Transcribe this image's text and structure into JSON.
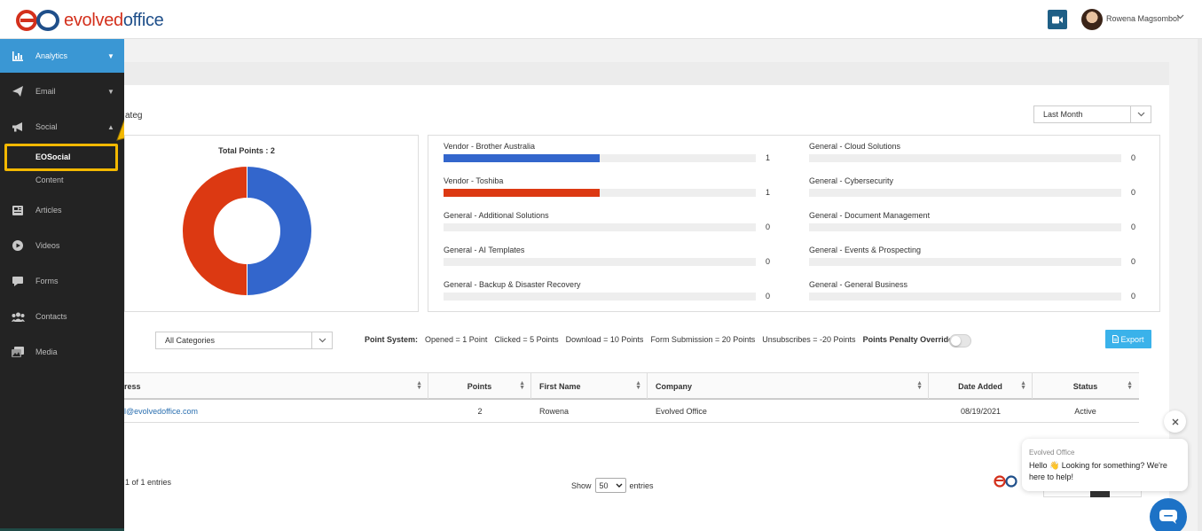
{
  "header": {
    "logo_evolved": "evolved",
    "logo_office": "office",
    "user_name": "Rowena Magsombol",
    "icons": {
      "video": "video-camera-icon",
      "chevron": "chevron-down-icon"
    }
  },
  "sidebar": {
    "items": [
      {
        "label": "Analytics",
        "icon": "bar-chart-icon",
        "active": true
      },
      {
        "label": "Email",
        "icon": "paper-plane-icon"
      },
      {
        "label": "Social",
        "icon": "megaphone-icon",
        "expanded": true
      },
      {
        "label": "Articles",
        "icon": "newspaper-icon"
      },
      {
        "label": "Videos",
        "icon": "play-circle-icon"
      },
      {
        "label": "Forms",
        "icon": "comment-icon"
      },
      {
        "label": "Contacts",
        "icon": "users-icon"
      },
      {
        "label": "Media",
        "icon": "images-icon"
      }
    ],
    "social_sub": [
      "EOSocial",
      "Content"
    ],
    "colors": {
      "active": "#3a97d4",
      "highlight": "#f3b800"
    }
  },
  "main": {
    "clipped_title": "ateg",
    "period_select": "Last Month",
    "category_select": "All Categories",
    "chart_data": {
      "type": "pie",
      "title": "Total Points : 2",
      "categories": [
        "Vendor - Brother Australia",
        "Vendor - Toshiba"
      ],
      "values": [
        1,
        1
      ],
      "colors": [
        "#3366cc",
        "#dc3912"
      ],
      "donut": true
    },
    "category_bars": {
      "max": 2,
      "items": [
        {
          "label": "Vendor - Brother Australia",
          "value": 1,
          "color": "#3366cc"
        },
        {
          "label": "Vendor - Toshiba",
          "value": 1,
          "color": "#dc3912"
        },
        {
          "label": "General - Additional Solutions",
          "value": 0
        },
        {
          "label": "General - AI Templates",
          "value": 0
        },
        {
          "label": "General - Backup & Disaster Recovery",
          "value": 0
        },
        {
          "label": "General - Cloud Solutions",
          "value": 0
        },
        {
          "label": "General - Cybersecurity",
          "value": 0
        },
        {
          "label": "General - Document Management",
          "value": 0
        },
        {
          "label": "General - Events & Prospecting",
          "value": 0
        },
        {
          "label": "General - General Business",
          "value": 0
        }
      ]
    },
    "point_system": {
      "label": "Point System:",
      "rules": [
        "Opened = 1 Point",
        "Clicked = 5 Points",
        "Download = 10 Points",
        "Form Submission = 20 Points",
        "Unsubscribes = -20 Points"
      ],
      "penalty_label": "Points Penalty Override",
      "penalty_on": false
    },
    "export_label": "Export",
    "table": {
      "columns": [
        "ress",
        "Points",
        "First Name",
        "Company",
        "Date Added",
        "Status"
      ],
      "rows": [
        [
          "l@evolvedoffice.com",
          "2",
          "Rowena",
          "Evolved Office",
          "08/19/2021",
          "Active"
        ]
      ]
    },
    "entries_info": "1 of 1 entries",
    "show_label": "Show",
    "show_value": "50",
    "entries_label": "entries"
  },
  "chat": {
    "sender": "Evolved Office",
    "message": "Hello 👋 Looking for something? We're here to help!",
    "close_icon": "close-icon",
    "launcher_icon": "chat-bubble-icon"
  }
}
